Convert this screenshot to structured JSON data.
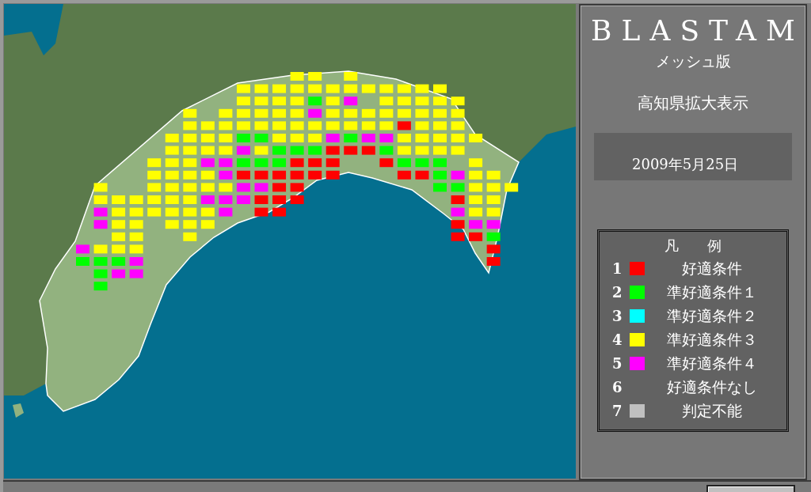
{
  "sidebar": {
    "title": "BLASTAM",
    "subtitle": "メッシュ版",
    "view": "高知県拡大表示",
    "date": "2009年5月25日"
  },
  "legend": {
    "title": "凡　　例",
    "items": [
      {
        "number": "1",
        "label": "好適条件",
        "color": "#ff0000"
      },
      {
        "number": "2",
        "label": "準好適条件１",
        "color": "#00ff00"
      },
      {
        "number": "3",
        "label": "準好適条件２",
        "color": "#00ffff"
      },
      {
        "number": "4",
        "label": "準好適条件３",
        "color": "#ffff00"
      },
      {
        "number": "5",
        "label": "準好適条件４",
        "color": "#ff00ff"
      },
      {
        "number": "6",
        "label": "好適条件なし"
      },
      {
        "number": "7",
        "label": "判定不能",
        "color": "#c0c0c0"
      }
    ]
  },
  "mesh_rows": [
    [
      {
        "kind": "empty"
      },
      {
        "kind": "empty"
      },
      {
        "kind": "empty"
      },
      {
        "kind": "empty"
      },
      {
        "kind": "empty"
      },
      {
        "kind": "empty"
      },
      {
        "kind": "empty"
      },
      {
        "kind": "empty"
      },
      {
        "kind": "empty"
      },
      {
        "kind": "empty"
      },
      {
        "kind": "empty"
      },
      {
        "kind": "empty"
      },
      {
        "kind": "cat4"
      },
      {
        "kind": "cat4"
      },
      {
        "kind": "empty"
      },
      {
        "kind": "cat4"
      }
    ],
    [
      {
        "kind": "empty"
      },
      {
        "kind": "empty"
      },
      {
        "kind": "empty"
      },
      {
        "kind": "empty"
      },
      {
        "kind": "empty"
      },
      {
        "kind": "empty"
      },
      {
        "kind": "empty"
      },
      {
        "kind": "empty"
      },
      {
        "kind": "empty"
      },
      {
        "kind": "cat4"
      },
      {
        "kind": "cat4"
      },
      {
        "kind": "cat4"
      },
      {
        "kind": "cat4"
      },
      {
        "kind": "cat4"
      },
      {
        "kind": "cat4"
      },
      {
        "kind": "cat4"
      },
      {
        "kind": "cat4"
      },
      {
        "kind": "cat4"
      },
      {
        "kind": "cat4"
      },
      {
        "kind": "cat4"
      },
      {
        "kind": "cat4"
      }
    ],
    [
      {
        "kind": "empty"
      },
      {
        "kind": "empty"
      },
      {
        "kind": "empty"
      },
      {
        "kind": "empty"
      },
      {
        "kind": "empty"
      },
      {
        "kind": "empty"
      },
      {
        "kind": "empty"
      },
      {
        "kind": "empty"
      },
      {
        "kind": "empty"
      },
      {
        "kind": "cat4"
      },
      {
        "kind": "cat4"
      },
      {
        "kind": "cat4"
      },
      {
        "kind": "cat4"
      },
      {
        "kind": "cat2"
      },
      {
        "kind": "cat4"
      },
      {
        "kind": "cat5"
      },
      {
        "kind": "empty"
      },
      {
        "kind": "cat4"
      },
      {
        "kind": "cat4"
      },
      {
        "kind": "cat4"
      },
      {
        "kind": "cat4"
      },
      {
        "kind": "cat4"
      }
    ],
    [
      {
        "kind": "empty"
      },
      {
        "kind": "empty"
      },
      {
        "kind": "empty"
      },
      {
        "kind": "empty"
      },
      {
        "kind": "empty"
      },
      {
        "kind": "empty"
      },
      {
        "kind": "cat4"
      },
      {
        "kind": "empty"
      },
      {
        "kind": "cat4"
      },
      {
        "kind": "cat4"
      },
      {
        "kind": "cat4"
      },
      {
        "kind": "cat4"
      },
      {
        "kind": "cat4"
      },
      {
        "kind": "cat5"
      },
      {
        "kind": "cat4"
      },
      {
        "kind": "cat4"
      },
      {
        "kind": "cat4"
      },
      {
        "kind": "cat4"
      },
      {
        "kind": "cat4"
      },
      {
        "kind": "cat4"
      },
      {
        "kind": "cat4"
      },
      {
        "kind": "cat4"
      }
    ],
    [
      {
        "kind": "empty"
      },
      {
        "kind": "empty"
      },
      {
        "kind": "empty"
      },
      {
        "kind": "empty"
      },
      {
        "kind": "empty"
      },
      {
        "kind": "empty"
      },
      {
        "kind": "cat4"
      },
      {
        "kind": "cat4"
      },
      {
        "kind": "cat4"
      },
      {
        "kind": "cat4"
      },
      {
        "kind": "cat4"
      },
      {
        "kind": "cat4"
      },
      {
        "kind": "cat4"
      },
      {
        "kind": "cat4"
      },
      {
        "kind": "cat4"
      },
      {
        "kind": "cat4"
      },
      {
        "kind": "cat4"
      },
      {
        "kind": "cat4"
      },
      {
        "kind": "cat1"
      },
      {
        "kind": "cat4"
      },
      {
        "kind": "cat4"
      },
      {
        "kind": "cat4"
      }
    ],
    [
      {
        "kind": "empty"
      },
      {
        "kind": "empty"
      },
      {
        "kind": "empty"
      },
      {
        "kind": "empty"
      },
      {
        "kind": "empty"
      },
      {
        "kind": "cat4"
      },
      {
        "kind": "cat4"
      },
      {
        "kind": "cat4"
      },
      {
        "kind": "cat4"
      },
      {
        "kind": "cat2"
      },
      {
        "kind": "cat2"
      },
      {
        "kind": "cat4"
      },
      {
        "kind": "cat4"
      },
      {
        "kind": "cat4"
      },
      {
        "kind": "cat5"
      },
      {
        "kind": "cat2"
      },
      {
        "kind": "cat5"
      },
      {
        "kind": "cat5"
      },
      {
        "kind": "cat4"
      },
      {
        "kind": "cat4"
      },
      {
        "kind": "cat4"
      },
      {
        "kind": "cat4"
      },
      {
        "kind": "cat4"
      }
    ],
    [
      {
        "kind": "empty"
      },
      {
        "kind": "empty"
      },
      {
        "kind": "empty"
      },
      {
        "kind": "empty"
      },
      {
        "kind": "empty"
      },
      {
        "kind": "cat4"
      },
      {
        "kind": "cat4"
      },
      {
        "kind": "cat4"
      },
      {
        "kind": "cat4"
      },
      {
        "kind": "cat5"
      },
      {
        "kind": "cat4"
      },
      {
        "kind": "cat2"
      },
      {
        "kind": "cat2"
      },
      {
        "kind": "cat2"
      },
      {
        "kind": "cat1"
      },
      {
        "kind": "cat1"
      },
      {
        "kind": "cat1"
      },
      {
        "kind": "cat2"
      },
      {
        "kind": "cat4"
      },
      {
        "kind": "cat4"
      },
      {
        "kind": "cat4"
      },
      {
        "kind": "cat4"
      }
    ],
    [
      {
        "kind": "empty"
      },
      {
        "kind": "empty"
      },
      {
        "kind": "empty"
      },
      {
        "kind": "empty"
      },
      {
        "kind": "cat4"
      },
      {
        "kind": "cat4"
      },
      {
        "kind": "cat4"
      },
      {
        "kind": "cat5"
      },
      {
        "kind": "cat5"
      },
      {
        "kind": "cat2"
      },
      {
        "kind": "cat2"
      },
      {
        "kind": "cat2"
      },
      {
        "kind": "cat1"
      },
      {
        "kind": "cat1"
      },
      {
        "kind": "cat1"
      },
      {
        "kind": "empty"
      },
      {
        "kind": "empty"
      },
      {
        "kind": "cat1"
      },
      {
        "kind": "cat2"
      },
      {
        "kind": "cat2"
      },
      {
        "kind": "cat2"
      },
      {
        "kind": "empty"
      },
      {
        "kind": "cat4"
      }
    ],
    [
      {
        "kind": "empty"
      },
      {
        "kind": "empty"
      },
      {
        "kind": "empty"
      },
      {
        "kind": "empty"
      },
      {
        "kind": "cat4"
      },
      {
        "kind": "cat4"
      },
      {
        "kind": "cat4"
      },
      {
        "kind": "cat4"
      },
      {
        "kind": "cat5"
      },
      {
        "kind": "cat1"
      },
      {
        "kind": "cat1"
      },
      {
        "kind": "cat1"
      },
      {
        "kind": "cat1"
      },
      {
        "kind": "cat1"
      },
      {
        "kind": "cat1"
      },
      {
        "kind": "empty"
      },
      {
        "kind": "empty"
      },
      {
        "kind": "empty"
      },
      {
        "kind": "cat1"
      },
      {
        "kind": "cat1"
      },
      {
        "kind": "cat2"
      },
      {
        "kind": "cat5"
      },
      {
        "kind": "cat4"
      },
      {
        "kind": "cat4"
      }
    ],
    [
      {
        "kind": "empty"
      },
      {
        "kind": "cat4"
      },
      {
        "kind": "empty"
      },
      {
        "kind": "empty"
      },
      {
        "kind": "cat4"
      },
      {
        "kind": "cat4"
      },
      {
        "kind": "cat4"
      },
      {
        "kind": "cat4"
      },
      {
        "kind": "cat4"
      },
      {
        "kind": "cat5"
      },
      {
        "kind": "cat5"
      },
      {
        "kind": "cat1"
      },
      {
        "kind": "cat1"
      },
      {
        "kind": "empty"
      },
      {
        "kind": "empty"
      },
      {
        "kind": "empty"
      },
      {
        "kind": "empty"
      },
      {
        "kind": "empty"
      },
      {
        "kind": "empty"
      },
      {
        "kind": "empty"
      },
      {
        "kind": "cat2"
      },
      {
        "kind": "cat2"
      },
      {
        "kind": "cat4"
      },
      {
        "kind": "cat4"
      },
      {
        "kind": "cat4"
      }
    ],
    [
      {
        "kind": "empty"
      },
      {
        "kind": "cat4"
      },
      {
        "kind": "cat4"
      },
      {
        "kind": "cat4"
      },
      {
        "kind": "cat4"
      },
      {
        "kind": "cat4"
      },
      {
        "kind": "cat4"
      },
      {
        "kind": "cat5"
      },
      {
        "kind": "cat5"
      },
      {
        "kind": "cat5"
      },
      {
        "kind": "cat1"
      },
      {
        "kind": "cat1"
      },
      {
        "kind": "cat1"
      },
      {
        "kind": "empty"
      },
      {
        "kind": "empty"
      },
      {
        "kind": "empty"
      },
      {
        "kind": "empty"
      },
      {
        "kind": "empty"
      },
      {
        "kind": "empty"
      },
      {
        "kind": "empty"
      },
      {
        "kind": "empty"
      },
      {
        "kind": "cat1"
      },
      {
        "kind": "cat4"
      },
      {
        "kind": "cat4"
      }
    ],
    [
      {
        "kind": "empty"
      },
      {
        "kind": "cat5"
      },
      {
        "kind": "cat4"
      },
      {
        "kind": "cat4"
      },
      {
        "kind": "cat4"
      },
      {
        "kind": "cat4"
      },
      {
        "kind": "cat4"
      },
      {
        "kind": "cat4"
      },
      {
        "kind": "cat5"
      },
      {
        "kind": "empty"
      },
      {
        "kind": "cat1"
      },
      {
        "kind": "cat1"
      },
      {
        "kind": "empty"
      },
      {
        "kind": "empty"
      },
      {
        "kind": "empty"
      },
      {
        "kind": "empty"
      },
      {
        "kind": "empty"
      },
      {
        "kind": "empty"
      },
      {
        "kind": "empty"
      },
      {
        "kind": "empty"
      },
      {
        "kind": "empty"
      },
      {
        "kind": "cat5"
      },
      {
        "kind": "cat4"
      },
      {
        "kind": "cat4"
      }
    ],
    [
      {
        "kind": "empty"
      },
      {
        "kind": "cat5"
      },
      {
        "kind": "cat4"
      },
      {
        "kind": "cat4"
      },
      {
        "kind": "empty"
      },
      {
        "kind": "cat4"
      },
      {
        "kind": "cat4"
      },
      {
        "kind": "cat4"
      },
      {
        "kind": "empty"
      },
      {
        "kind": "empty"
      },
      {
        "kind": "empty"
      },
      {
        "kind": "empty"
      },
      {
        "kind": "empty"
      },
      {
        "kind": "empty"
      },
      {
        "kind": "empty"
      },
      {
        "kind": "empty"
      },
      {
        "kind": "empty"
      },
      {
        "kind": "empty"
      },
      {
        "kind": "empty"
      },
      {
        "kind": "empty"
      },
      {
        "kind": "empty"
      },
      {
        "kind": "cat1"
      },
      {
        "kind": "cat5"
      },
      {
        "kind": "cat5"
      }
    ],
    [
      {
        "kind": "empty"
      },
      {
        "kind": "empty"
      },
      {
        "kind": "cat4"
      },
      {
        "kind": "cat4"
      },
      {
        "kind": "empty"
      },
      {
        "kind": "empty"
      },
      {
        "kind": "cat4"
      },
      {
        "kind": "empty"
      },
      {
        "kind": "empty"
      },
      {
        "kind": "empty"
      },
      {
        "kind": "empty"
      },
      {
        "kind": "empty"
      },
      {
        "kind": "empty"
      },
      {
        "kind": "empty"
      },
      {
        "kind": "empty"
      },
      {
        "kind": "empty"
      },
      {
        "kind": "empty"
      },
      {
        "kind": "empty"
      },
      {
        "kind": "empty"
      },
      {
        "kind": "empty"
      },
      {
        "kind": "empty"
      },
      {
        "kind": "cat1"
      },
      {
        "kind": "cat1"
      },
      {
        "kind": "cat2"
      }
    ],
    [
      {
        "kind": "cat5"
      },
      {
        "kind": "cat4"
      },
      {
        "kind": "cat4"
      },
      {
        "kind": "cat4"
      },
      {
        "kind": "empty"
      },
      {
        "kind": "empty"
      },
      {
        "kind": "empty"
      },
      {
        "kind": "empty"
      },
      {
        "kind": "empty"
      },
      {
        "kind": "empty"
      },
      {
        "kind": "empty"
      },
      {
        "kind": "empty"
      },
      {
        "kind": "empty"
      },
      {
        "kind": "empty"
      },
      {
        "kind": "empty"
      },
      {
        "kind": "empty"
      },
      {
        "kind": "empty"
      },
      {
        "kind": "empty"
      },
      {
        "kind": "empty"
      },
      {
        "kind": "empty"
      },
      {
        "kind": "empty"
      },
      {
        "kind": "empty"
      },
      {
        "kind": "empty"
      },
      {
        "kind": "cat1"
      }
    ],
    [
      {
        "kind": "cat2"
      },
      {
        "kind": "cat2"
      },
      {
        "kind": "cat2"
      },
      {
        "kind": "cat5"
      },
      {
        "kind": "empty"
      },
      {
        "kind": "empty"
      },
      {
        "kind": "empty"
      },
      {
        "kind": "empty"
      },
      {
        "kind": "empty"
      },
      {
        "kind": "empty"
      },
      {
        "kind": "empty"
      },
      {
        "kind": "empty"
      },
      {
        "kind": "empty"
      },
      {
        "kind": "empty"
      },
      {
        "kind": "empty"
      },
      {
        "kind": "empty"
      },
      {
        "kind": "empty"
      },
      {
        "kind": "empty"
      },
      {
        "kind": "empty"
      },
      {
        "kind": "empty"
      },
      {
        "kind": "empty"
      },
      {
        "kind": "empty"
      },
      {
        "kind": "empty"
      },
      {
        "kind": "cat1"
      }
    ],
    [
      {
        "kind": "empty"
      },
      {
        "kind": "cat2"
      },
      {
        "kind": "cat5"
      },
      {
        "kind": "cat5"
      }
    ],
    [
      {
        "kind": "empty"
      },
      {
        "kind": "cat2"
      }
    ]
  ]
}
